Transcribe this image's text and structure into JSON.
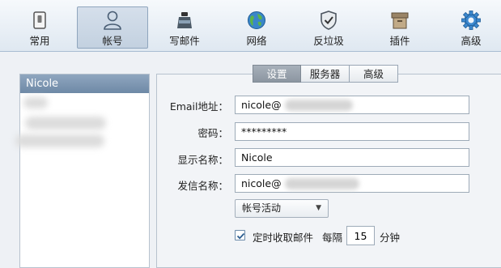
{
  "toolbar": {
    "items": [
      {
        "label": "常用",
        "icon": "general-switch-icon"
      },
      {
        "label": "帐号",
        "icon": "account-person-icon",
        "active": true
      },
      {
        "label": "写邮件",
        "icon": "compose-inkpot-icon"
      },
      {
        "label": "网络",
        "icon": "network-globe-icon"
      },
      {
        "label": "反垃圾",
        "icon": "antispam-shield-icon"
      },
      {
        "label": "插件",
        "icon": "plugin-box-icon"
      },
      {
        "label": "高级",
        "icon": "advanced-gear-icon"
      }
    ]
  },
  "accounts": {
    "selected": "Nicole"
  },
  "tabs": [
    {
      "label": "设置",
      "active": true
    },
    {
      "label": "服务器"
    },
    {
      "label": "高级"
    }
  ],
  "form": {
    "email_label": "Email地址：",
    "email_value": "nicole@",
    "password_label": "密码：",
    "password_value": "*********",
    "display_name_label": "显示名称：",
    "display_name_value": "Nicole",
    "sender_name_label": "发信名称：",
    "sender_name_value": "nicole@",
    "account_status": "帐号活动",
    "auto_receive_label": "定时收取邮件",
    "auto_receive_checked": true,
    "every_label": "每隔",
    "interval_value": "15",
    "minute_label": "分钟"
  },
  "colors": {
    "accent": "#6e89a6",
    "active_tab": "#8c96a1"
  }
}
